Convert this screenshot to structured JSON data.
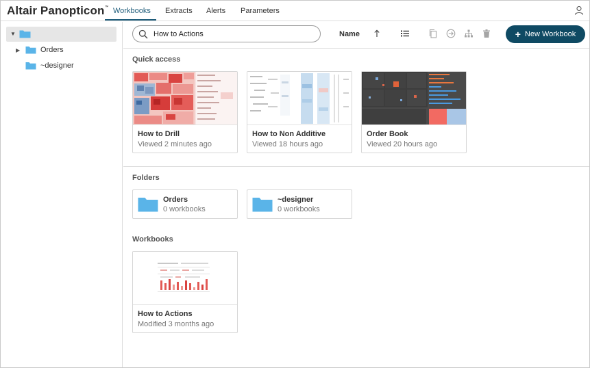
{
  "app": {
    "brand": "Altair Panopticon",
    "brand_mark": "™"
  },
  "nav": {
    "tabs": [
      "Workbooks",
      "Extracts",
      "Alerts",
      "Parameters"
    ],
    "active": "Workbooks"
  },
  "tree": {
    "root_label": "",
    "items": [
      {
        "label": "Orders",
        "expandable": true
      },
      {
        "label": "~designer",
        "expandable": false
      }
    ]
  },
  "search": {
    "value": "How to Actions",
    "placeholder": ""
  },
  "sort": {
    "label": "Name",
    "direction": "ascending"
  },
  "actions": {
    "new_workbook": "New Workbook"
  },
  "quick_access": {
    "heading": "Quick access",
    "items": [
      {
        "title": "How to Drill",
        "subtitle": "Viewed 2 minutes ago"
      },
      {
        "title": "How to Non Additive",
        "subtitle": "Viewed 18 hours ago"
      },
      {
        "title": "Order Book",
        "subtitle": "Viewed 20 hours ago"
      }
    ]
  },
  "folders": {
    "heading": "Folders",
    "items": [
      {
        "title": "Orders",
        "subtitle": "0 workbooks"
      },
      {
        "title": "~designer",
        "subtitle": "0 workbooks"
      }
    ]
  },
  "workbooks": {
    "heading": "Workbooks",
    "items": [
      {
        "title": "How to Actions",
        "subtitle": "Modified 3 months ago"
      }
    ]
  },
  "colors": {
    "accent": "#1e5c7a",
    "button": "#0f4a63",
    "folder": "#5ab4e8"
  }
}
